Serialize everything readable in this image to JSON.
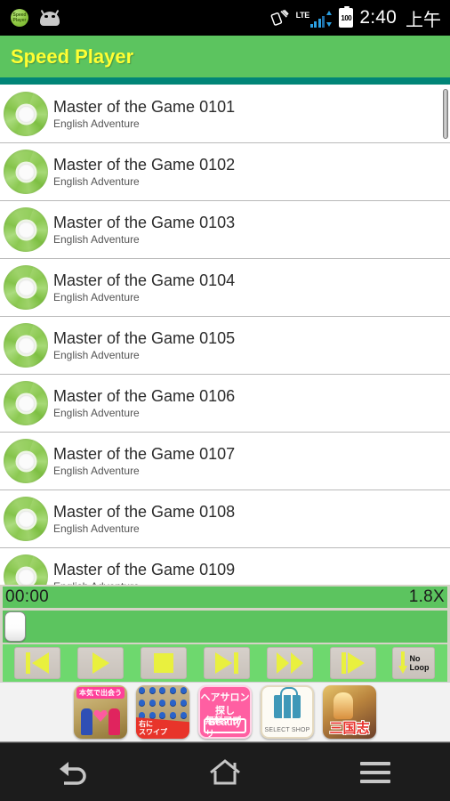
{
  "status_bar": {
    "notification_icons": [
      {
        "name": "speed-player-notification-icon",
        "label_line1": "Speed",
        "label_line2": "Player"
      },
      {
        "name": "android-robot-icon",
        "label": "android"
      }
    ],
    "rotation_icon": "screen-rotation-icon",
    "network_label": "LTE",
    "battery_level": "100",
    "time": "2:40",
    "am_pm": "上午"
  },
  "title_bar": {
    "title": "Speed Player",
    "bg_color": "#5cc45f",
    "text_color": "#ffff33",
    "rule_color": "#018577"
  },
  "list": {
    "items": [
      {
        "title": "Master of the Game 0101",
        "subtitle": "English Adventure",
        "icon": "cd-disc-icon"
      },
      {
        "title": "Master of the Game 0102",
        "subtitle": "English Adventure",
        "icon": "cd-disc-icon"
      },
      {
        "title": "Master of the Game 0103",
        "subtitle": "English Adventure",
        "icon": "cd-disc-icon"
      },
      {
        "title": "Master of the Game 0104",
        "subtitle": "English Adventure",
        "icon": "cd-disc-icon"
      },
      {
        "title": "Master of the Game 0105",
        "subtitle": "English Adventure",
        "icon": "cd-disc-icon"
      },
      {
        "title": "Master of the Game 0106",
        "subtitle": "English Adventure",
        "icon": "cd-disc-icon"
      },
      {
        "title": "Master of the Game 0107",
        "subtitle": "English Adventure",
        "icon": "cd-disc-icon"
      },
      {
        "title": "Master of the Game 0108",
        "subtitle": "English Adventure",
        "icon": "cd-disc-icon"
      },
      {
        "title": "Master of the Game 0109",
        "subtitle": "English Adventure",
        "icon": "cd-disc-icon"
      }
    ]
  },
  "player": {
    "elapsed_time": "00:00",
    "speed": "1.8X",
    "seek_position_percent": 0,
    "track_color": "#5cc45f",
    "controls": [
      {
        "name": "previous-button",
        "icon": "skip-previous-icon"
      },
      {
        "name": "play-button",
        "icon": "play-icon"
      },
      {
        "name": "stop-button",
        "icon": "stop-icon"
      },
      {
        "name": "next-button",
        "icon": "skip-next-icon"
      },
      {
        "name": "fast-forward-button",
        "icon": "fast-forward-icon"
      },
      {
        "name": "step-forward-button",
        "icon": "step-forward-icon"
      },
      {
        "name": "loop-mode-button",
        "icon": "down-arrow-icon",
        "label_line1": "No",
        "label_line2": "Loop"
      }
    ]
  },
  "ads": [
    {
      "name": "ad-dating",
      "tag": "本気で出会う"
    },
    {
      "name": "ad-swipe-game",
      "line1": "右に",
      "line2": "スワイプ"
    },
    {
      "name": "ad-hair-salon",
      "line1": "ヘアサロン",
      "line2": "探しBeauty",
      "line3": "無料アプリ"
    },
    {
      "name": "ad-select-shop",
      "caption": "SELECT SHOP"
    },
    {
      "name": "ad-sangokushi",
      "title": "三国志"
    }
  ],
  "nav_bar": {
    "back": "back-button",
    "home": "home-button",
    "recents": "recent-apps-button"
  }
}
